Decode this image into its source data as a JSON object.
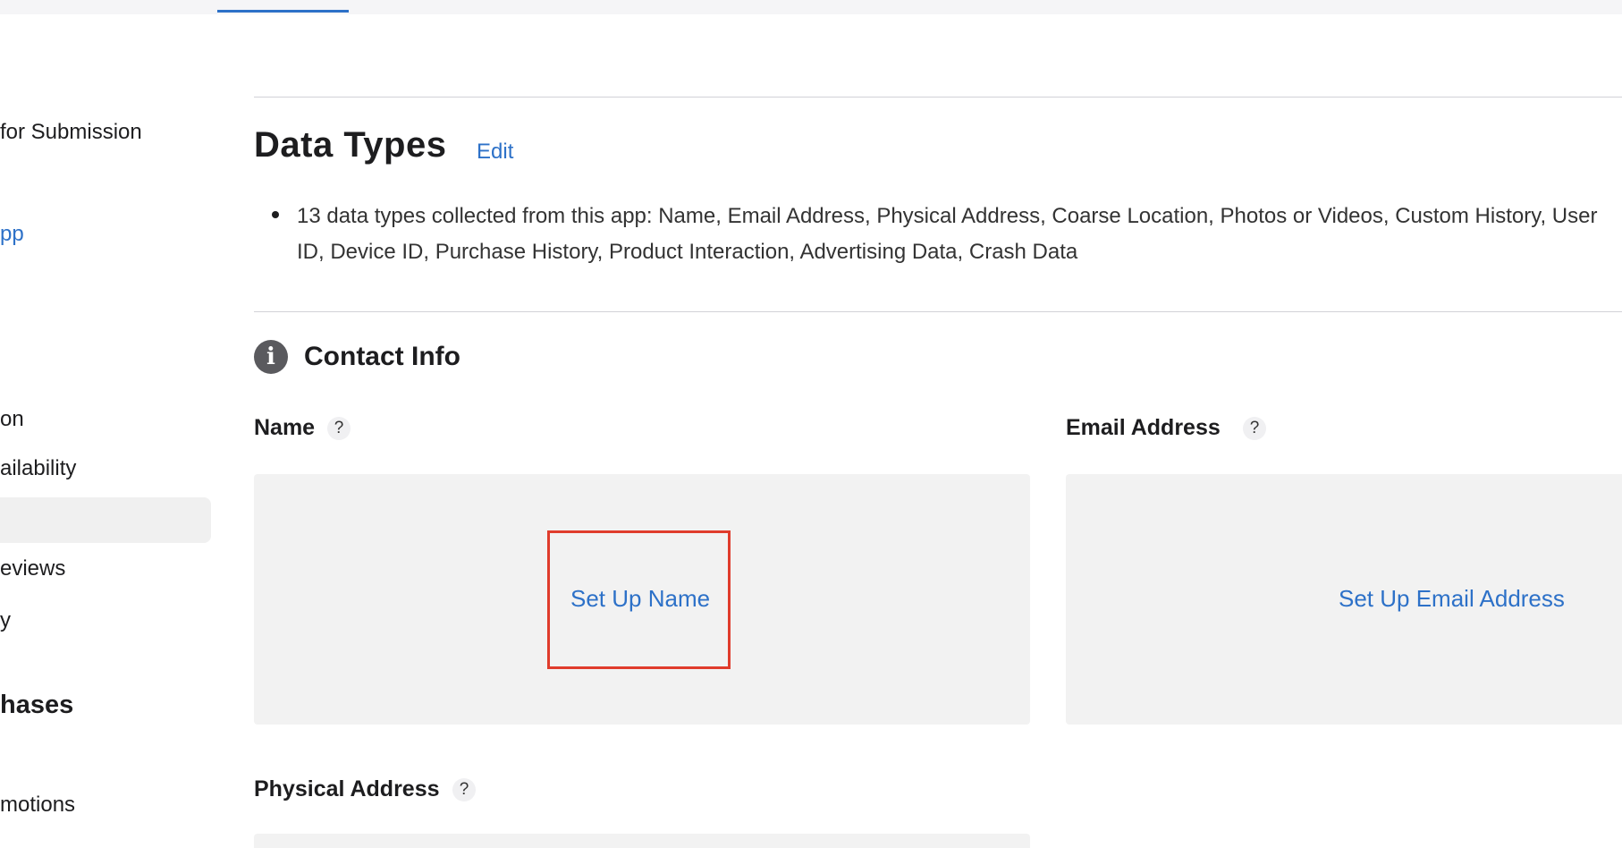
{
  "sidebar": {
    "items": [
      {
        "label": "for Submission"
      },
      {
        "label": "pp"
      },
      {
        "label": "on"
      },
      {
        "label": "ailability"
      },
      {
        "label": "eviews"
      },
      {
        "label": "y"
      },
      {
        "label": "hases"
      },
      {
        "label": "motions"
      }
    ]
  },
  "data_types": {
    "title": "Data Types",
    "edit_label": "Edit",
    "summary": "13 data types collected from this app: Name, Email Address, Physical Address, Coarse Location, Photos or Videos, Custom History, User ID, Device ID, Purchase History, Product Interaction, Advertising Data, Crash Data"
  },
  "contact_info": {
    "title": "Contact Info",
    "icon": "info-icon",
    "fields": [
      {
        "label": "Name",
        "help": "?",
        "action": "Set Up Name"
      },
      {
        "label": "Email Address",
        "help": "?",
        "action": "Set Up Email Address"
      },
      {
        "label": "Physical Address",
        "help": "?"
      }
    ]
  },
  "colors": {
    "accent": "#2d71c8",
    "highlight": "#e03c2c",
    "card_bg": "#f2f2f2"
  }
}
